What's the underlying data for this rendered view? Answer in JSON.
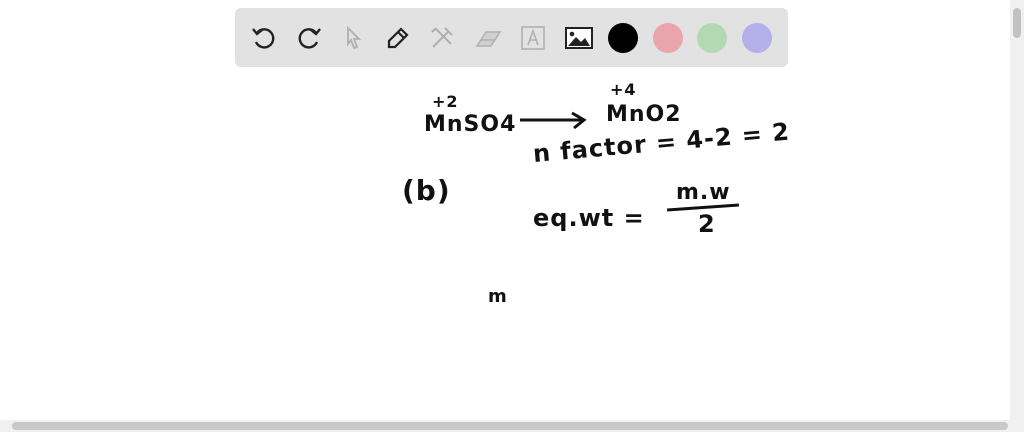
{
  "toolbar": {
    "tools": [
      {
        "name": "undo-icon"
      },
      {
        "name": "redo-icon"
      },
      {
        "name": "select-pointer-icon"
      },
      {
        "name": "pencil-icon"
      },
      {
        "name": "tools-icon"
      },
      {
        "name": "eraser-icon"
      },
      {
        "name": "text-icon"
      },
      {
        "name": "image-icon"
      }
    ],
    "colors": {
      "black": "#000000",
      "red": "#e8a5ab",
      "green": "#b3d9b3",
      "purple": "#b4b0ea"
    }
  },
  "canvas": {
    "ox_state_left": "+2",
    "reactant": "MnSO4",
    "ox_state_right": "+4",
    "product": "MnO2",
    "n_factor": "n factor = 4-2 = 2",
    "part_label": "(b)",
    "eq_wt": "eq.wt =",
    "numerator": "m.w",
    "denominator": "2",
    "stray": "m"
  }
}
